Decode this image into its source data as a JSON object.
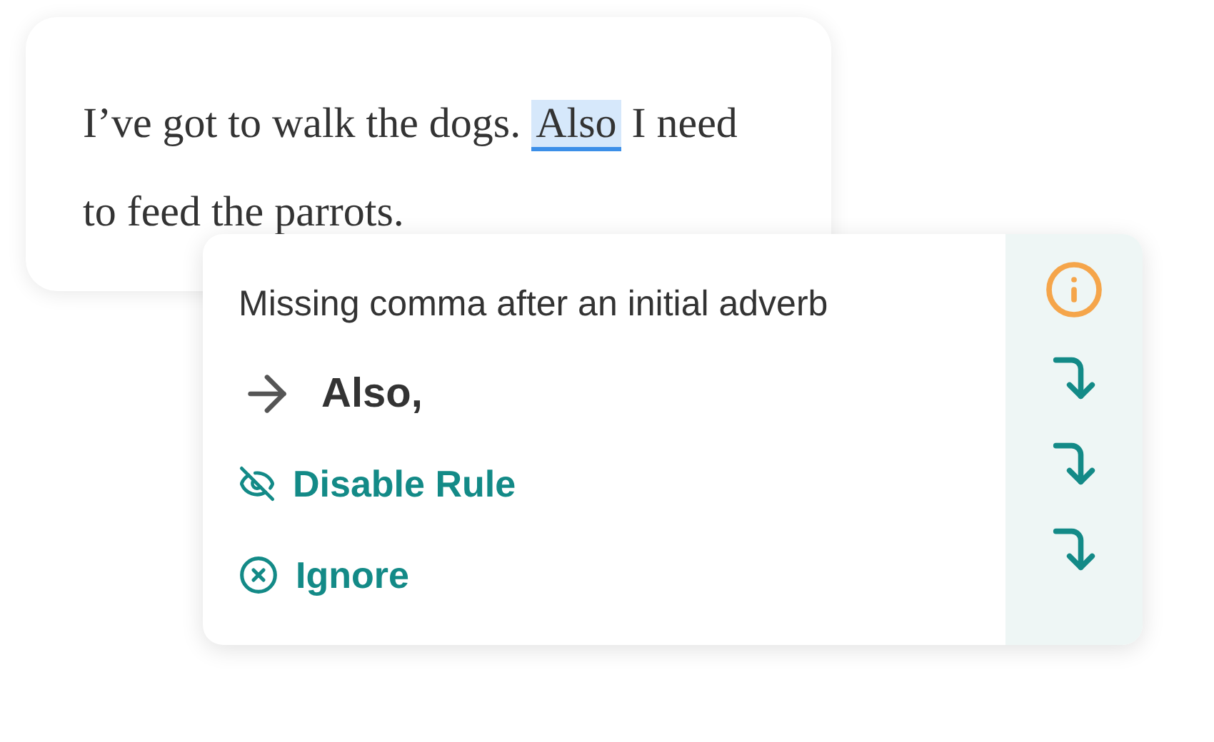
{
  "editor": {
    "text_before": "I’ve got to walk the dogs.",
    "flagged_word": "Also",
    "text_after": "I need to feed the parrots."
  },
  "popup": {
    "message": "Missing comma after an initial adverb",
    "suggestion": "Also,",
    "actions": [
      {
        "kind": "disable",
        "label": "Disable Rule"
      },
      {
        "kind": "ignore",
        "label": "Ignore"
      }
    ]
  }
}
